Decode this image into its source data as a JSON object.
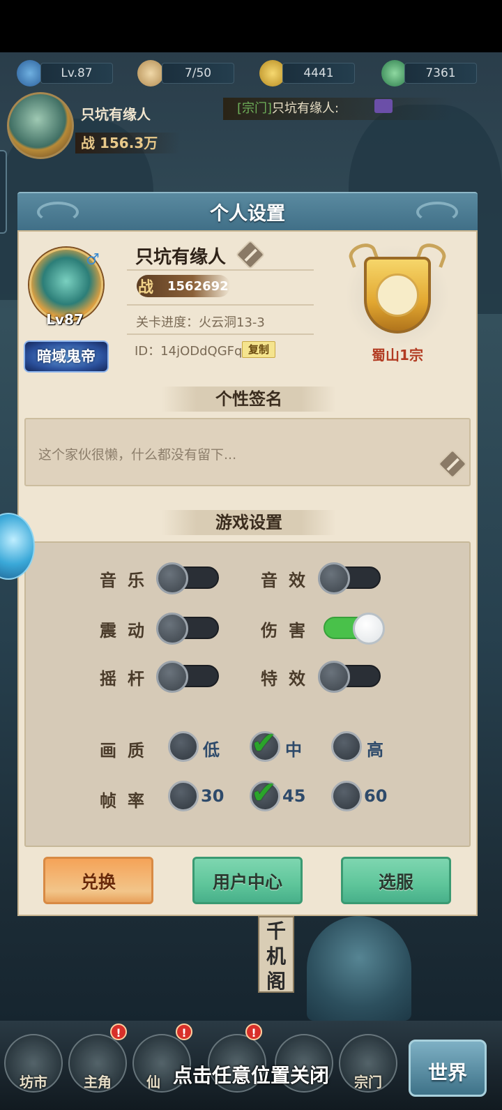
{
  "hud": {
    "level": "Lv.87",
    "stamina": "7/50",
    "coins": "4441",
    "jade": "7361",
    "player_name": "只坑有缘人",
    "power_label": "战",
    "power_value": "156.3万"
  },
  "chat": {
    "channel": "[宗门]",
    "speaker": "只坑有缘人:"
  },
  "panel": {
    "title": "个人设置",
    "profile": {
      "name": "只坑有缘人",
      "level": "Lv87",
      "title_badge": "暗域鬼帝",
      "power_label": "战",
      "power_value": "1562692",
      "stage_progress": "关卡进度：火云洞13-3",
      "id": "ID：14jODdQGFq",
      "copy_label": "复制",
      "sect_name": "蜀山1宗"
    },
    "signature": {
      "header": "个性签名",
      "text": "这个家伙很懒，什么都没有留下..."
    },
    "game_settings": {
      "header": "游戏设置",
      "toggles": [
        {
          "label": "音乐",
          "on": false
        },
        {
          "label": "音效",
          "on": false
        },
        {
          "label": "震动",
          "on": false
        },
        {
          "label": "伤害",
          "on": true
        },
        {
          "label": "摇杆",
          "on": false
        },
        {
          "label": "特效",
          "on": false
        }
      ],
      "quality": {
        "label": "画质",
        "options": [
          "低",
          "中",
          "高"
        ],
        "selected": "中"
      },
      "framerate": {
        "label": "帧率",
        "options": [
          "30",
          "45",
          "60"
        ],
        "selected": "45"
      }
    },
    "buttons": {
      "redeem": "兑换",
      "user_center": "用户中心",
      "server_select": "选服"
    }
  },
  "world_scene": {
    "pavilion_text": "千机阁"
  },
  "bottom_nav": {
    "items": [
      "坊市",
      "主角",
      "仙",
      "宗门",
      "世界"
    ],
    "badges": [
      "!",
      "!",
      "!"
    ]
  },
  "close_hint": "点击任意位置关闭",
  "colors": {
    "toggle_on": "#49c14a",
    "check_green": "#2aa52a",
    "sect_red": "#b23b22",
    "panel_bg": "#efe5d2"
  }
}
